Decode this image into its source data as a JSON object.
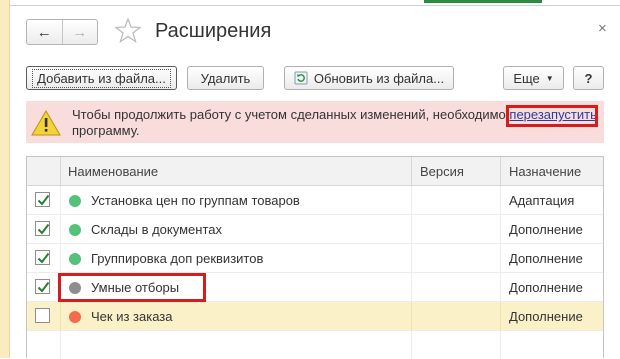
{
  "window": {
    "title": "Расширения",
    "nav_back_glyph": "←",
    "nav_forward_glyph": "→",
    "close_glyph": "×"
  },
  "toolbar": {
    "add_from_file": "Добавить из файла...",
    "delete": "Удалить",
    "update_from_file": "Обновить из файла...",
    "more": "Еще",
    "more_caret": "▼",
    "help": "?"
  },
  "warning": {
    "text_before": "Чтобы продолжить работу с учетом сделанных изменений, необходимо",
    "link": "перезапустить",
    "text_after": "программу."
  },
  "table": {
    "columns": {
      "name": "Наименование",
      "version": "Версия",
      "purpose": "Назначение"
    },
    "rows": [
      {
        "checked": true,
        "status": "green",
        "name": "Установка цен по группам товаров",
        "version": "",
        "purpose": "Адаптация"
      },
      {
        "checked": true,
        "status": "green",
        "name": "Склады в документах",
        "version": "",
        "purpose": "Дополнение"
      },
      {
        "checked": true,
        "status": "green",
        "name": "Группировка доп реквизитов",
        "version": "",
        "purpose": "Дополнение"
      },
      {
        "checked": true,
        "status": "gray",
        "name": "Умные отборы",
        "version": "",
        "purpose": "Дополнение"
      },
      {
        "checked": false,
        "status": "red",
        "name": "Чек из заказа",
        "version": "",
        "purpose": "Дополнение"
      }
    ]
  },
  "colors": {
    "accent_green": "#2c8a43",
    "warning_bg": "#f9dcdc",
    "highlight_red": "#d61c1c",
    "selected_row": "#fbf1c8",
    "status_green": "#55c27a",
    "status_gray": "#8e8e8e",
    "status_red": "#f26b4d"
  },
  "icons": [
    "star-icon",
    "warning-icon",
    "refresh-icon",
    "close-icon",
    "arrow-left-icon",
    "arrow-right-icon"
  ]
}
